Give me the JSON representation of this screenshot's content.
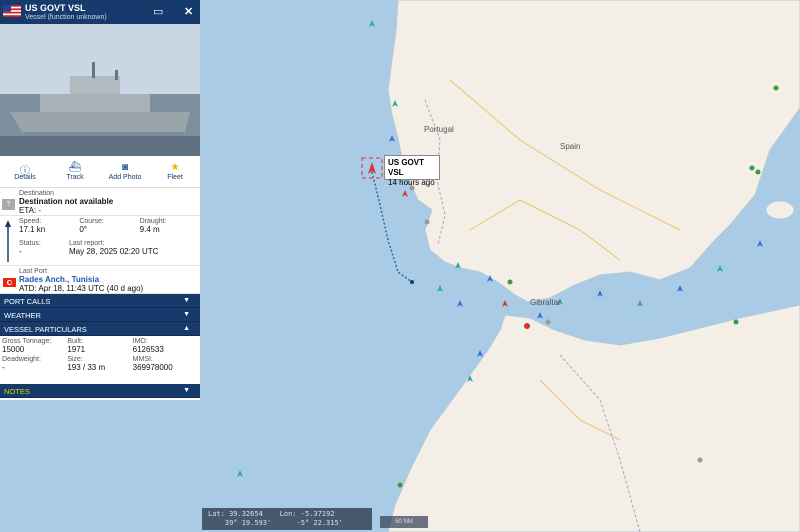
{
  "vessel": {
    "name": "US GOVT VSL",
    "type": "Vessel (function unknown)",
    "flag": "us-flag-icon"
  },
  "actions": [
    {
      "label": "Details",
      "icon": "info-icon"
    },
    {
      "label": "Track",
      "icon": "ship-track-icon"
    },
    {
      "label": "Add Photo",
      "icon": "camera-icon"
    },
    {
      "label": "Fleet",
      "icon": "star-icon"
    }
  ],
  "destination": {
    "label": "Destination",
    "value": "Destination not available",
    "eta": "ETA: -"
  },
  "voyage": {
    "speed_label": "Speed:",
    "speed": "17.1 kn",
    "course_label": "Course:",
    "course": "0°",
    "draught_label": "Draught:",
    "draught": "9.4 m",
    "status_label": "Status:",
    "status": "-",
    "last_report_label": "Last report:",
    "last_report": "May 28, 2025 02:20 UTC"
  },
  "last_port": {
    "label": "Last Port",
    "name": "Rades Anch., Tunisia",
    "atd": "ATD: Apr 18, 11:43 UTC (40 d ago)"
  },
  "sections": {
    "port_calls": "PORT CALLS",
    "weather": "WEATHER",
    "particulars": "VESSEL PARTICULARS",
    "notes": "NOTES"
  },
  "particulars": {
    "gt_label": "Gross Tonnage:",
    "gt": "15000",
    "built_label": "Built:",
    "built": "1971",
    "imo_label": "IMO:",
    "imo": "6126533",
    "dwt_label": "Deadweight:",
    "dwt": "-",
    "size_label": "Size:",
    "size": "193 / 33 m",
    "mmsi_label": "MMSI:",
    "mmsi": "369978000"
  },
  "tooltip": {
    "name": "US GOVT VSL",
    "age": "14 hours ago"
  },
  "map_labels": {
    "portugal": "Portugal",
    "spain": "Spain",
    "gibraltar": "Gibraltar"
  },
  "coords": {
    "lat_label": "Lat:",
    "lat": "39.32654",
    "lon_label": "Lon:",
    "lon": "-5.37192",
    "lat_dms": "39° 19.593'",
    "lon_dms": "-5° 22.315'"
  },
  "scale": "50 NM",
  "colors": {
    "sea": "#a9cbe6",
    "land": "#f3efe6",
    "panel_header": "#163a6b",
    "track": "#2a6aa8",
    "ship": "#d8342a"
  }
}
